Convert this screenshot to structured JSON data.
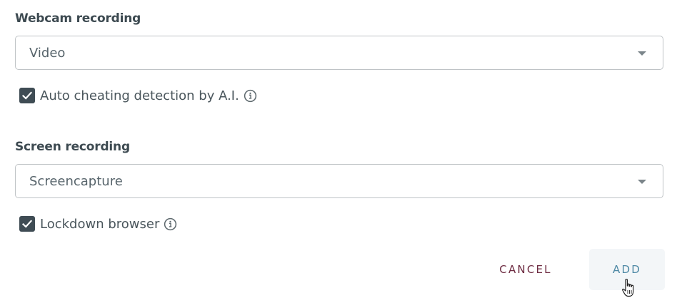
{
  "webcam": {
    "title": "Webcam recording",
    "select_value": "Video",
    "checkbox_label": "Auto cheating detection by A.I.",
    "checkbox_checked": true
  },
  "screen": {
    "title": "Screen recording",
    "select_value": "Screencapture",
    "checkbox_label": "Lockdown browser",
    "checkbox_checked": true
  },
  "actions": {
    "cancel_label": "CANCEL",
    "add_label": "ADD"
  },
  "colors": {
    "checkbox": "#3f4c54",
    "cancel": "#6e2c42",
    "add": "#4e89a5"
  },
  "icons": {
    "dropdown": "chevron-down-icon",
    "info": "info-icon",
    "check": "check-icon",
    "cursor": "hand-pointer-cursor"
  }
}
